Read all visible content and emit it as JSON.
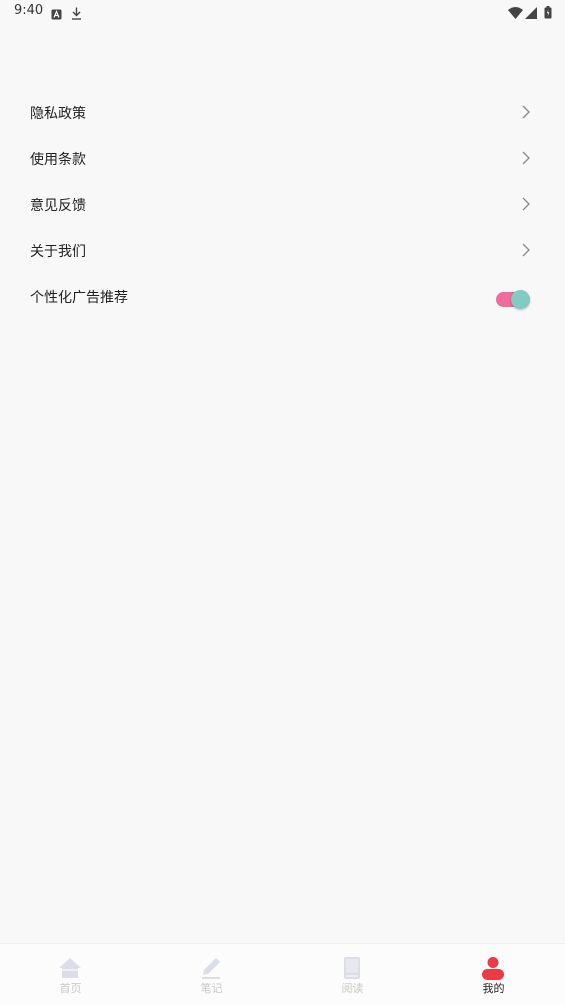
{
  "status_bar": {
    "time": "9:40"
  },
  "menu": {
    "items": [
      {
        "label": "隐私政策"
      },
      {
        "label": "使用条款"
      },
      {
        "label": "意见反馈"
      },
      {
        "label": "关于我们"
      }
    ],
    "toggle_item": {
      "label": "个性化广告推荐",
      "enabled": true
    }
  },
  "bottom_nav": {
    "items": [
      {
        "label": "首页",
        "icon": "home-icon",
        "active": false
      },
      {
        "label": "笔记",
        "icon": "pencil-icon",
        "active": false
      },
      {
        "label": "阅读",
        "icon": "book-icon",
        "active": false
      },
      {
        "label": "我的",
        "icon": "user-icon",
        "active": true
      }
    ]
  },
  "colors": {
    "background": "#f8f8f8",
    "toggle_track": "#f06c9b",
    "toggle_knob": "#82cbc3",
    "active_icon": "#ee3a46",
    "inactive_icon": "#dcdde6"
  }
}
